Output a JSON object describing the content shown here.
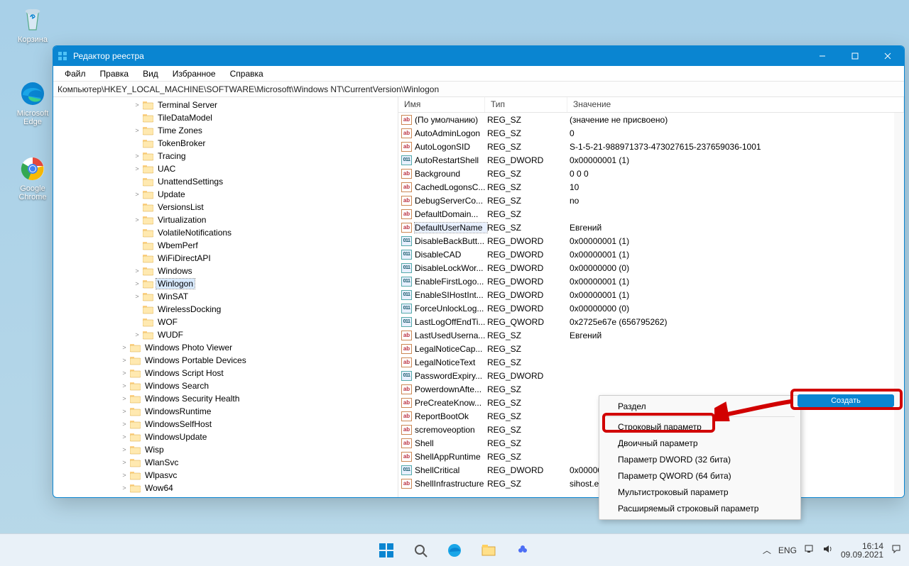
{
  "desktop": {
    "icons": [
      {
        "name": "recycle-bin",
        "label": "Корзина"
      },
      {
        "name": "edge",
        "label": "Microsoft Edge"
      },
      {
        "name": "chrome",
        "label": "Google Chrome"
      }
    ]
  },
  "window": {
    "title": "Редактор реестра",
    "menu": [
      "Файл",
      "Правка",
      "Вид",
      "Избранное",
      "Справка"
    ],
    "address": "Компьютер\\HKEY_LOCAL_MACHINE\\SOFTWARE\\Microsoft\\Windows NT\\CurrentVersion\\Winlogon",
    "tree": [
      {
        "depth": 4,
        "caret": ">",
        "label": "Terminal Server"
      },
      {
        "depth": 4,
        "caret": "",
        "label": "TileDataModel"
      },
      {
        "depth": 4,
        "caret": ">",
        "label": "Time Zones"
      },
      {
        "depth": 4,
        "caret": "",
        "label": "TokenBroker"
      },
      {
        "depth": 4,
        "caret": ">",
        "label": "Tracing"
      },
      {
        "depth": 4,
        "caret": ">",
        "label": "UAC"
      },
      {
        "depth": 4,
        "caret": "",
        "label": "UnattendSettings"
      },
      {
        "depth": 4,
        "caret": ">",
        "label": "Update"
      },
      {
        "depth": 4,
        "caret": "",
        "label": "VersionsList"
      },
      {
        "depth": 4,
        "caret": ">",
        "label": "Virtualization"
      },
      {
        "depth": 4,
        "caret": "",
        "label": "VolatileNotifications"
      },
      {
        "depth": 4,
        "caret": "",
        "label": "WbemPerf"
      },
      {
        "depth": 4,
        "caret": "",
        "label": "WiFiDirectAPI"
      },
      {
        "depth": 4,
        "caret": ">",
        "label": "Windows"
      },
      {
        "depth": 4,
        "caret": ">",
        "label": "Winlogon",
        "selected": true
      },
      {
        "depth": 4,
        "caret": ">",
        "label": "WinSAT"
      },
      {
        "depth": 4,
        "caret": "",
        "label": "WirelessDocking"
      },
      {
        "depth": 4,
        "caret": "",
        "label": "WOF"
      },
      {
        "depth": 4,
        "caret": ">",
        "label": "WUDF"
      },
      {
        "depth": 3,
        "caret": ">",
        "label": "Windows Photo Viewer"
      },
      {
        "depth": 3,
        "caret": ">",
        "label": "Windows Portable Devices"
      },
      {
        "depth": 3,
        "caret": ">",
        "label": "Windows Script Host"
      },
      {
        "depth": 3,
        "caret": ">",
        "label": "Windows Search"
      },
      {
        "depth": 3,
        "caret": ">",
        "label": "Windows Security Health"
      },
      {
        "depth": 3,
        "caret": ">",
        "label": "WindowsRuntime"
      },
      {
        "depth": 3,
        "caret": ">",
        "label": "WindowsSelfHost"
      },
      {
        "depth": 3,
        "caret": ">",
        "label": "WindowsUpdate"
      },
      {
        "depth": 3,
        "caret": ">",
        "label": "Wisp"
      },
      {
        "depth": 3,
        "caret": ">",
        "label": "WlanSvc"
      },
      {
        "depth": 3,
        "caret": ">",
        "label": "Wlpasvc"
      },
      {
        "depth": 3,
        "caret": ">",
        "label": "Wow64"
      }
    ],
    "columns": {
      "name": "Имя",
      "type": "Тип",
      "value": "Значение"
    },
    "values": [
      {
        "ico": "ab",
        "name": "(По умолчанию)",
        "type": "REG_SZ",
        "value": "(значение не присвоено)"
      },
      {
        "ico": "ab",
        "name": "AutoAdminLogon",
        "type": "REG_SZ",
        "value": "0"
      },
      {
        "ico": "ab",
        "name": "AutoLogonSID",
        "type": "REG_SZ",
        "value": "S-1-5-21-988971373-473027615-237659036-1001"
      },
      {
        "ico": "num",
        "name": "AutoRestartShell",
        "type": "REG_DWORD",
        "value": "0x00000001 (1)"
      },
      {
        "ico": "ab",
        "name": "Background",
        "type": "REG_SZ",
        "value": "0 0 0"
      },
      {
        "ico": "ab",
        "name": "CachedLogonsC...",
        "type": "REG_SZ",
        "value": "10"
      },
      {
        "ico": "ab",
        "name": "DebugServerCo...",
        "type": "REG_SZ",
        "value": "no"
      },
      {
        "ico": "ab",
        "name": "DefaultDomain...",
        "type": "REG_SZ",
        "value": ""
      },
      {
        "ico": "ab",
        "name": "DefaultUserName",
        "type": "REG_SZ",
        "value": "Евгений",
        "selected": true
      },
      {
        "ico": "num",
        "name": "DisableBackButt...",
        "type": "REG_DWORD",
        "value": "0x00000001 (1)"
      },
      {
        "ico": "num",
        "name": "DisableCAD",
        "type": "REG_DWORD",
        "value": "0x00000001 (1)"
      },
      {
        "ico": "num",
        "name": "DisableLockWor...",
        "type": "REG_DWORD",
        "value": "0x00000000 (0)"
      },
      {
        "ico": "num",
        "name": "EnableFirstLogo...",
        "type": "REG_DWORD",
        "value": "0x00000001 (1)"
      },
      {
        "ico": "num",
        "name": "EnableSIHostInt...",
        "type": "REG_DWORD",
        "value": "0x00000001 (1)"
      },
      {
        "ico": "num",
        "name": "ForceUnlockLog...",
        "type": "REG_DWORD",
        "value": "0x00000000 (0)"
      },
      {
        "ico": "num",
        "name": "LastLogOffEndTi...",
        "type": "REG_QWORD",
        "value": "0x2725e67e (656795262)"
      },
      {
        "ico": "ab",
        "name": "LastUsedUserna...",
        "type": "REG_SZ",
        "value": "Евгений"
      },
      {
        "ico": "ab",
        "name": "LegalNoticeCap...",
        "type": "REG_SZ",
        "value": ""
      },
      {
        "ico": "ab",
        "name": "LegalNoticeText",
        "type": "REG_SZ",
        "value": ""
      },
      {
        "ico": "num",
        "name": "PasswordExpiry...",
        "type": "REG_DWORD",
        "value": ""
      },
      {
        "ico": "ab",
        "name": "PowerdownAfte...",
        "type": "REG_SZ",
        "value": ""
      },
      {
        "ico": "ab",
        "name": "PreCreateKnow...",
        "type": "REG_SZ",
        "value": ""
      },
      {
        "ico": "ab",
        "name": "ReportBootOk",
        "type": "REG_SZ",
        "value": ""
      },
      {
        "ico": "ab",
        "name": "scremoveoption",
        "type": "REG_SZ",
        "value": ""
      },
      {
        "ico": "ab",
        "name": "Shell",
        "type": "REG_SZ",
        "value": ""
      },
      {
        "ico": "ab",
        "name": "ShellAppRuntime",
        "type": "REG_SZ",
        "value": ""
      },
      {
        "ico": "num",
        "name": "ShellCritical",
        "type": "REG_DWORD",
        "value": "0x00000000 (0)"
      },
      {
        "ico": "ab",
        "name": "ShellInfrastructure",
        "type": "REG_SZ",
        "value": "sihost.exe"
      }
    ]
  },
  "context_parent": {
    "label": "Создать"
  },
  "context_menu": {
    "items": [
      {
        "label": "Раздел",
        "sep_after": true
      },
      {
        "label": "Строковый параметр",
        "hl": true
      },
      {
        "label": "Двоичный параметр"
      },
      {
        "label": "Параметр DWORD (32 бита)"
      },
      {
        "label": "Параметр QWORD (64 бита)"
      },
      {
        "label": "Мультистроковый параметр"
      },
      {
        "label": "Расширяемый строковый параметр"
      }
    ]
  },
  "taskbar": {
    "lang": "ENG",
    "time": "16:14",
    "date": "09.09.2021"
  }
}
